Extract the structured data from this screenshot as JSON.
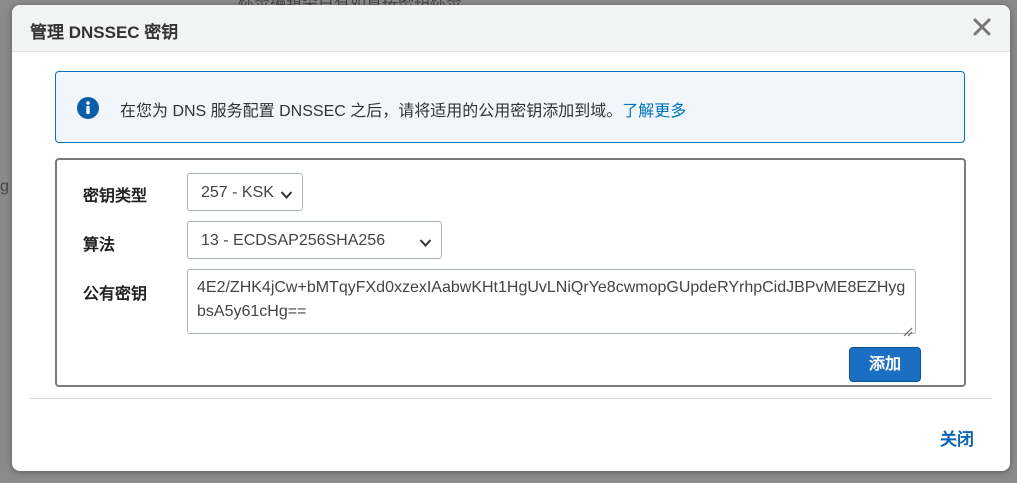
{
  "background": {
    "top_text": "标签编辑类目有如直接密钥标签",
    "left_text": "g"
  },
  "modal": {
    "title": "管理 DNSSEC 密钥",
    "close_icon": "close-x-icon"
  },
  "info": {
    "icon": "info-circle-icon",
    "text": "在您为 DNS 服务配置 DNSSEC 之后，请将适用的公用密钥添加到域。",
    "link": "了解更多",
    "accent": "#0073bb"
  },
  "form": {
    "key_type": {
      "label": "密钥类型",
      "value": "257 - KSK"
    },
    "algorithm": {
      "label": "算法",
      "value": "13 - ECDSAP256SHA256"
    },
    "public_key": {
      "label": "公有密钥",
      "value": "4E2/ZHK4jCw+bMTqyFXd0xzexIAabwKHt1HgUvLNiQrYe8cwmopGUpdeRYrhpCidJBPvME8EZHygbsA5y61cHg=="
    },
    "add_button": "添加",
    "button_color": "#1b6fc3"
  },
  "footer": {
    "close_link": "关闭"
  }
}
